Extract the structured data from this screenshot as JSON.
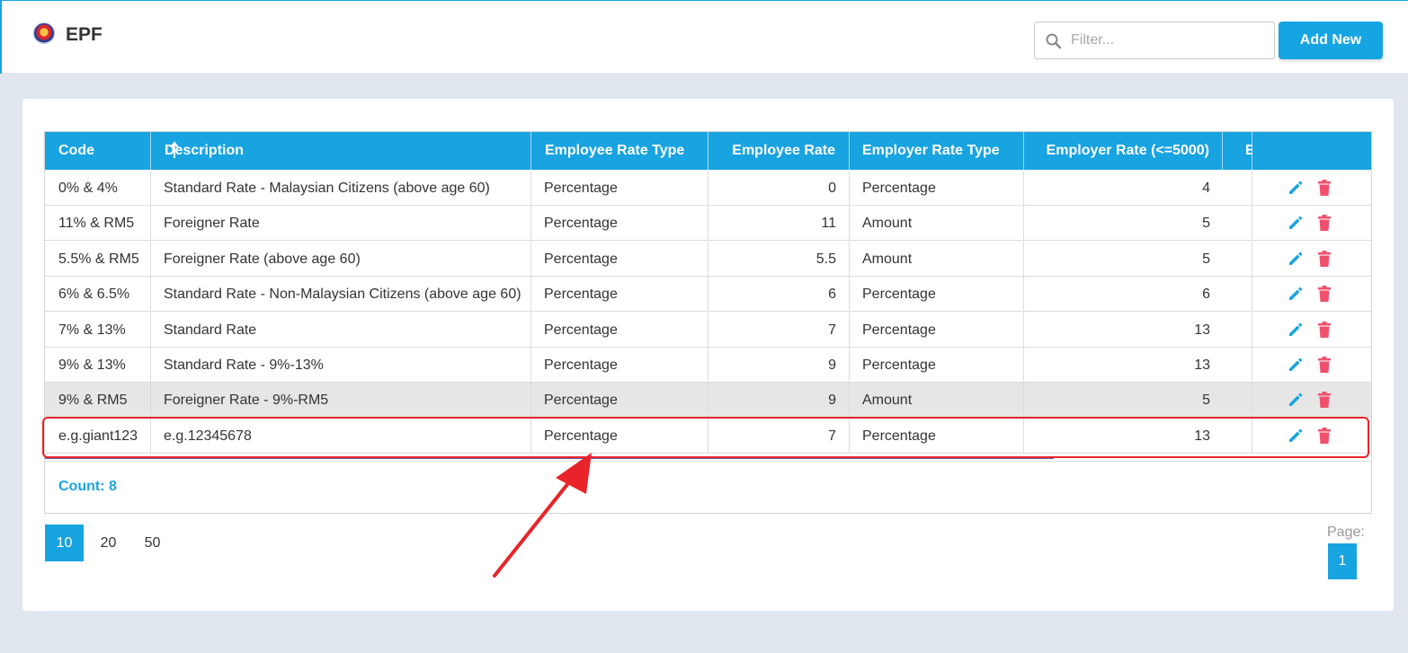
{
  "header": {
    "title": "EPF",
    "filter_placeholder": "Filter...",
    "add_label": "Add New"
  },
  "table": {
    "columns": [
      "Code",
      "Description",
      "Employee Rate Type",
      "Employee Rate",
      "Employer Rate Type",
      "Employer Rate (<=5000)",
      "E"
    ],
    "rows": [
      {
        "code": "0% & 4%",
        "description": "Standard Rate - Malaysian Citizens (above age 60)",
        "employee_rate_type": "Percentage",
        "employee_rate": "0",
        "employer_rate_type": "Percentage",
        "employer_rate": "4"
      },
      {
        "code": "11% & RM5",
        "description": "Foreigner Rate",
        "employee_rate_type": "Percentage",
        "employee_rate": "11",
        "employer_rate_type": "Amount",
        "employer_rate": "5"
      },
      {
        "code": "5.5% & RM5",
        "description": "Foreigner Rate (above age 60)",
        "employee_rate_type": "Percentage",
        "employee_rate": "5.5",
        "employer_rate_type": "Amount",
        "employer_rate": "5"
      },
      {
        "code": "6% & 6.5%",
        "description": "Standard Rate - Non-Malaysian Citizens (above age 60)",
        "employee_rate_type": "Percentage",
        "employee_rate": "6",
        "employer_rate_type": "Percentage",
        "employer_rate": "6"
      },
      {
        "code": "7% & 13%",
        "description": "Standard Rate",
        "employee_rate_type": "Percentage",
        "employee_rate": "7",
        "employer_rate_type": "Percentage",
        "employer_rate": "13"
      },
      {
        "code": "9% & 13%",
        "description": "Standard Rate - 9%-13%",
        "employee_rate_type": "Percentage",
        "employee_rate": "9",
        "employer_rate_type": "Percentage",
        "employer_rate": "13"
      },
      {
        "code": "9% & RM5",
        "description": "Foreigner Rate - 9%-RM5",
        "employee_rate_type": "Percentage",
        "employee_rate": "9",
        "employer_rate_type": "Amount",
        "employer_rate": "5"
      },
      {
        "code": "e.g.giant123",
        "description": "e.g.12345678",
        "employee_rate_type": "Percentage",
        "employee_rate": "7",
        "employer_rate_type": "Percentage",
        "employer_rate": "13"
      }
    ],
    "count_label": "Count: 8"
  },
  "pagination": {
    "page_sizes": [
      "10",
      "20",
      "50"
    ],
    "page_label": "Page:",
    "current_page": "1"
  },
  "colors": {
    "accent": "#18a3e1",
    "delete": "#f0506e",
    "annotation": "#e8242a"
  }
}
